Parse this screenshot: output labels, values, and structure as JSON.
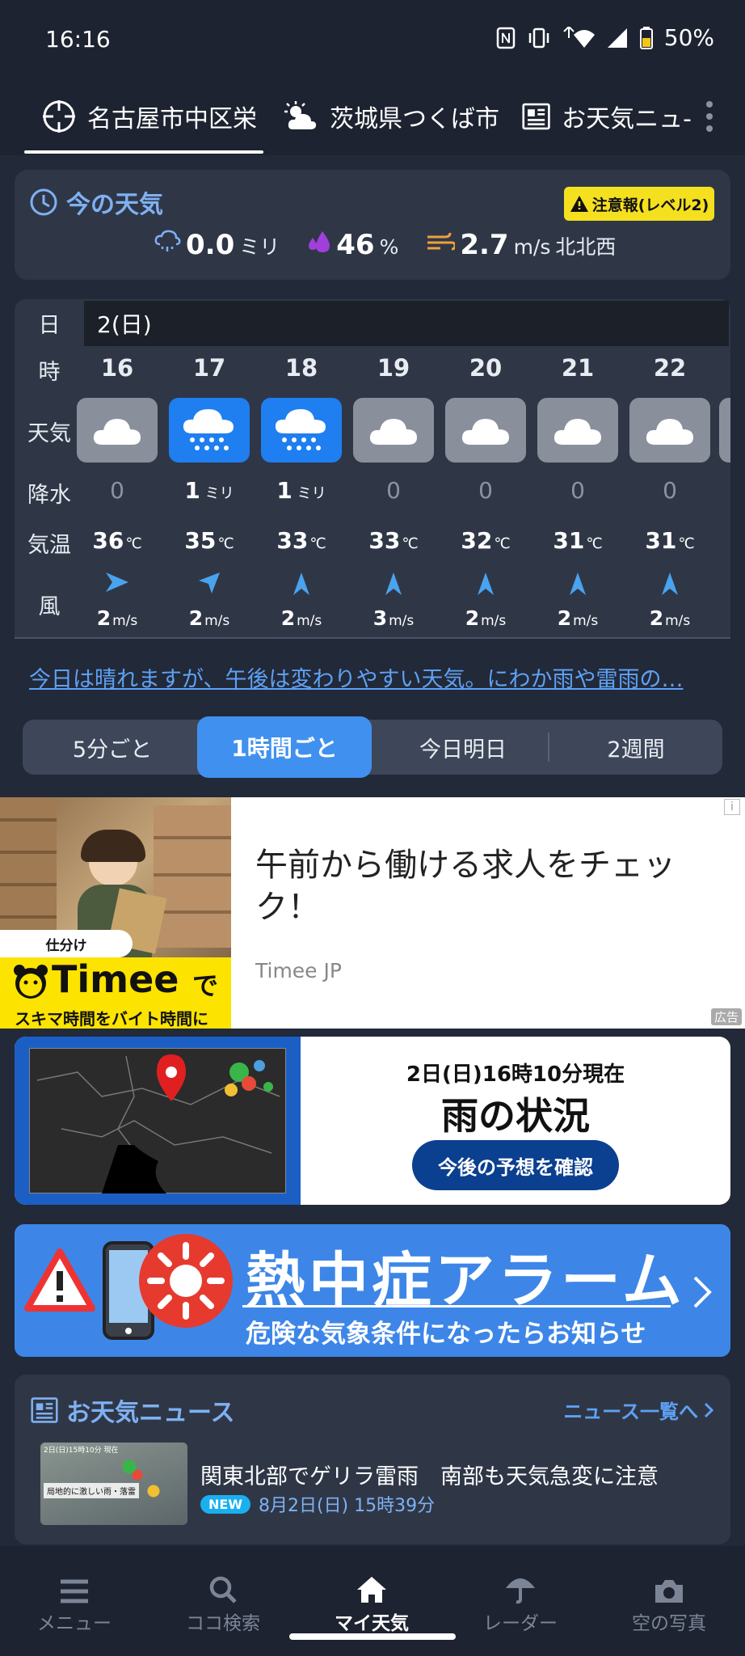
{
  "status_bar": {
    "time": "16:16",
    "battery": "50%"
  },
  "location_tabs": [
    {
      "label": "名古屋市中区栄",
      "icon": "location-target-icon"
    },
    {
      "label": "茨城県つくば市",
      "icon": "partly-cloudy-icon"
    },
    {
      "label": "お天気ニュ‐",
      "icon": "newspaper-icon"
    }
  ],
  "current": {
    "title": "今の天気",
    "alert": "注意報(レベル2)",
    "precip_value": "0.0",
    "precip_unit": "ミリ",
    "humidity_value": "46",
    "humidity_unit": "%",
    "wind_value": "2.7",
    "wind_unit": "m/s",
    "wind_dir": "北北西"
  },
  "hourly": {
    "row_labels": {
      "day": "日",
      "hour": "時",
      "weather": "天気",
      "precip": "降水",
      "temp": "気温",
      "wind": "風"
    },
    "day": "2(日)",
    "temp_unit": "℃",
    "wind_unit": "m/s",
    "precip_unit": "ミリ",
    "hours": [
      {
        "hour": "16",
        "weather": "cloudy",
        "precip": "0",
        "temp": "36",
        "wind": "2",
        "wind_icon": "wind-arrow-east-icon"
      },
      {
        "hour": "17",
        "weather": "rain",
        "precip": "1",
        "temp": "35",
        "wind": "2",
        "wind_icon": "wind-arrow-northeast-icon"
      },
      {
        "hour": "18",
        "weather": "rain",
        "precip": "1",
        "temp": "33",
        "wind": "2",
        "wind_icon": "wind-arrow-north-icon"
      },
      {
        "hour": "19",
        "weather": "cloudy",
        "precip": "0",
        "temp": "33",
        "wind": "3",
        "wind_icon": "wind-arrow-north-icon"
      },
      {
        "hour": "20",
        "weather": "cloudy",
        "precip": "0",
        "temp": "32",
        "wind": "2",
        "wind_icon": "wind-arrow-north-icon"
      },
      {
        "hour": "21",
        "weather": "cloudy",
        "precip": "0",
        "temp": "31",
        "wind": "2",
        "wind_icon": "wind-arrow-north-icon"
      },
      {
        "hour": "22",
        "weather": "cloudy",
        "precip": "0",
        "temp": "31",
        "wind": "2",
        "wind_icon": "wind-arrow-north-icon"
      }
    ]
  },
  "forecast_text": "今日は晴れますが、午後は変わりやすい天気。にわか雨や雷雨の…",
  "segments": [
    "5分ごと",
    "1時間ごと",
    "今日明日",
    "2週間"
  ],
  "ad": {
    "title": "午前から働ける求人をチェック！",
    "source": "Timee JP",
    "brand": "Timee",
    "brand_suffix": "で",
    "tagline": "スキマ時間をバイト時間に",
    "tag": "仕分け",
    "ad_label": "広告"
  },
  "rain_card": {
    "timestamp": "2日(日)16時10分現在",
    "title": "雨の状況",
    "button": "今後の予想を確認"
  },
  "heat_banner": {
    "title": "熱中症アラーム",
    "subtitle": "危険な気象条件になったらお知らせ"
  },
  "news": {
    "title": "お天気ニュース",
    "more_link": "ニュース一覧へ",
    "thumb_caption": "局地的に激しい雨・落雷",
    "thumb_time": "2日(日)15時10分 現在",
    "items": [
      {
        "headline": "関東北部でゲリラ雷雨　南部も天気急変に注意",
        "badge": "NEW",
        "date": "8月2日(日) 15時39分"
      }
    ]
  },
  "bottom_nav": [
    {
      "label": "メニュー",
      "icon": "menu-icon"
    },
    {
      "label": "ココ検索",
      "icon": "search-icon"
    },
    {
      "label": "マイ天気",
      "icon": "home-icon"
    },
    {
      "label": "レーダー",
      "icon": "umbrella-icon"
    },
    {
      "label": "空の写真",
      "icon": "camera-icon"
    }
  ],
  "colors": {
    "bg": "#222938",
    "card": "#2f3747",
    "accent": "#4091ef",
    "link": "#5ea1f5",
    "alert": "#f5e020"
  }
}
